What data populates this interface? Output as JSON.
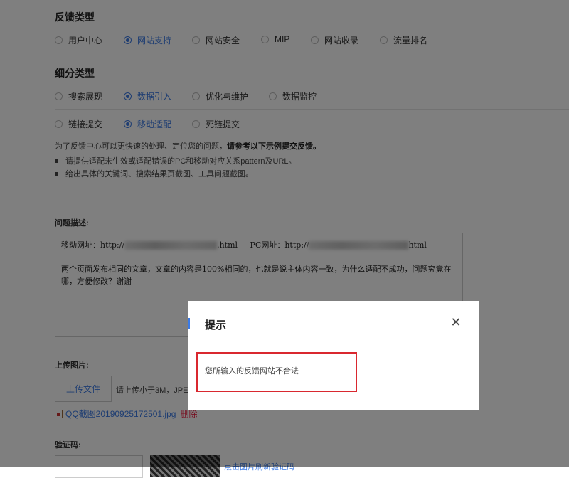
{
  "feedback_type": {
    "heading": "反馈类型",
    "options": [
      "用户中心",
      "网站支持",
      "网站安全",
      "MIP",
      "网站收录",
      "流量排名"
    ],
    "selected": "网站支持"
  },
  "sub_type": {
    "heading": "细分类型",
    "row1": [
      "搜索展现",
      "数据引入",
      "优化与维护",
      "数据监控"
    ],
    "row1_selected": "数据引入",
    "row2": [
      "链接提交",
      "移动适配",
      "死链提交"
    ],
    "row2_selected": "移动适配"
  },
  "hint": {
    "intro": "为了反馈中心可以更快速的处理、定位您的问题，",
    "intro_bold": "请参考以下示例提交反馈。",
    "bullets": [
      "请提供适配未生效或适配错误的PC和移动对应关系pattern及URL。",
      "给出具体的关键词、搜索结果页截图、工具问题截图。"
    ]
  },
  "problem": {
    "label": "问题描述:",
    "line1_mobile_prefix": "移动网址：http://",
    "line1_mobile_suffix": ".html",
    "line1_pc_prefix": "PC网址：http://",
    "line1_pc_suffix": "html",
    "body": "两个页面发布相同的文章，文章的内容是100%相同的，也就是说主体内容一致，为什么适配不成功，问题究竟在哪，方便修改？谢谢"
  },
  "upload": {
    "label": "上传图片:",
    "button": "上传文件",
    "tip": "请上传小于3M，JPEG",
    "file_name": "QQ截图20190925172501.jpg",
    "delete": "删除"
  },
  "captcha": {
    "label": "验证码:",
    "refresh_link": "点击图片刷新验证码"
  },
  "modal": {
    "title": "提示",
    "close": "✕",
    "message": "您所输入的反馈网站不合法"
  },
  "colors": {
    "accent": "#3c7be5",
    "highlight": "#d9282f",
    "delete": "#ee2244"
  }
}
